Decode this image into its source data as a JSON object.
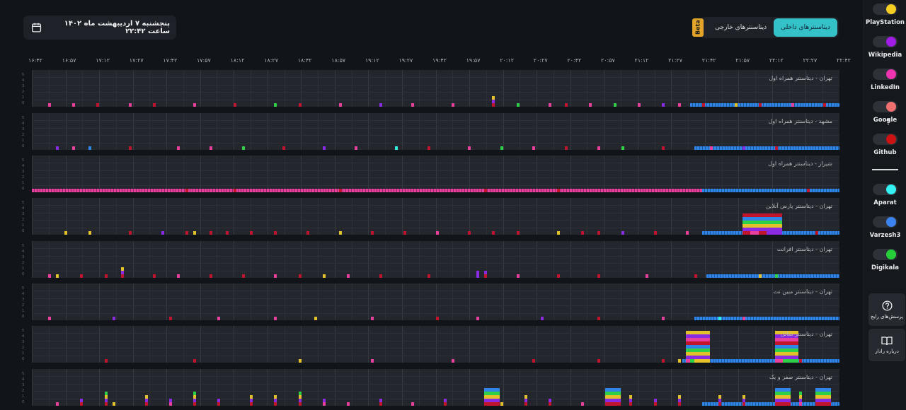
{
  "header": {
    "date_text": "پنجشنبه ۷ اردیبهشت ماه ۱۴۰۲ ساعت ۲۲:۴۲",
    "calendar_icon": "calendar-icon"
  },
  "tabs": {
    "active": "دیتاسنترهای داخلی",
    "inactive": "دیتاسنترهای خارجی",
    "beta": "Beta"
  },
  "time_axis": [
    "۱۶:۴۲",
    "۱۶:۵۷",
    "۱۷:۱۲",
    "۱۷:۲۷",
    "۱۷:۴۲",
    "۱۷:۵۷",
    "۱۸:۱۲",
    "۱۸:۲۷",
    "۱۸:۴۲",
    "۱۸:۵۷",
    "۱۹:۱۲",
    "۱۹:۲۷",
    "۱۹:۴۲",
    "۱۹:۵۷",
    "۲۰:۱۲",
    "۲۰:۲۷",
    "۲۰:۴۲",
    "۲۰:۵۷",
    "۲۱:۱۲",
    "۲۱:۲۷",
    "۲۱:۴۲",
    "۲۱:۵۷",
    "۲۲:۱۲",
    "۲۲:۲۷",
    "۲۲:۴۲"
  ],
  "rows": [
    {
      "label": "تهران - دیتاسنتر همراه اول",
      "base": {
        "start": 0.815,
        "color": "#2f86e8"
      },
      "bars": [
        [
          0.02,
          "#e8409d"
        ],
        [
          0.05,
          "#e8409d"
        ],
        [
          0.08,
          "#c0152c"
        ],
        [
          0.12,
          "#e8409d"
        ],
        [
          0.15,
          "#c0152c"
        ],
        [
          0.2,
          "#e8409d"
        ],
        [
          0.25,
          "#c0152c"
        ],
        [
          0.3,
          "#2fcf47"
        ],
        [
          0.33,
          "#c0152c"
        ],
        [
          0.38,
          "#e8409d"
        ],
        [
          0.43,
          "#8a2be2"
        ],
        [
          0.47,
          "#e8409d"
        ],
        [
          0.52,
          "#e8409d"
        ],
        [
          0.57,
          "#c0152c",
          3
        ],
        [
          0.6,
          "#2fcf47"
        ],
        [
          0.64,
          "#e8409d"
        ],
        [
          0.66,
          "#c0152c"
        ],
        [
          0.69,
          "#e8409d"
        ],
        [
          0.72,
          "#2fcf47"
        ],
        [
          0.75,
          "#e8409d"
        ],
        [
          0.78,
          "#8a2be2"
        ],
        [
          0.8,
          "#e8409d"
        ],
        [
          0.83,
          "#c0152c"
        ],
        [
          0.87,
          "#e3c12a"
        ],
        [
          0.9,
          "#c0152c"
        ],
        [
          0.94,
          "#e8409d"
        ],
        [
          0.98,
          "#c0152c"
        ]
      ]
    },
    {
      "label": "مشهد - دیتاسنتر همراه اول",
      "base": {
        "start": 0.82,
        "color": "#2f86e8"
      },
      "bars": [
        [
          0.03,
          "#8a2be2"
        ],
        [
          0.05,
          "#e8409d"
        ],
        [
          0.07,
          "#2f86e8"
        ],
        [
          0.12,
          "#c0152c"
        ],
        [
          0.18,
          "#e8409d"
        ],
        [
          0.22,
          "#e8409d"
        ],
        [
          0.26,
          "#2fcf47"
        ],
        [
          0.31,
          "#c0152c"
        ],
        [
          0.36,
          "#8a2be2"
        ],
        [
          0.4,
          "#e8409d"
        ],
        [
          0.45,
          "#2ff0e0"
        ],
        [
          0.49,
          "#c0152c"
        ],
        [
          0.54,
          "#e8409d"
        ],
        [
          0.58,
          "#2fcf47"
        ],
        [
          0.62,
          "#e8409d"
        ],
        [
          0.66,
          "#c0152c"
        ],
        [
          0.7,
          "#e8409d"
        ],
        [
          0.73,
          "#2fcf47"
        ],
        [
          0.78,
          "#c0152c"
        ],
        [
          0.84,
          "#e8409d"
        ],
        [
          0.88,
          "#8a2be2"
        ],
        [
          0.92,
          "#c0152c"
        ]
      ]
    },
    {
      "label": "شیراز - دیتاسنتر همراه اول",
      "base": {
        "start": 0.0,
        "color": "#e8409d"
      },
      "overlay": {
        "start": 0.83,
        "color": "#2f86e8"
      },
      "bars": [
        [
          0.19,
          "#c0152c"
        ],
        [
          0.25,
          "#c0152c"
        ],
        [
          0.38,
          "#c0152c"
        ],
        [
          0.56,
          "#c0152c"
        ],
        [
          0.65,
          "#c0152c"
        ],
        [
          0.96,
          "#c0152c"
        ]
      ]
    },
    {
      "label": "تهران - دیتاسنتر پارس آنلاین",
      "base": {
        "start": 0.83,
        "color": "#2f86e8"
      },
      "bars": [
        [
          0.04,
          "#e3c12a"
        ],
        [
          0.07,
          "#e3c12a"
        ],
        [
          0.12,
          "#c0152c"
        ],
        [
          0.16,
          "#8a2be2"
        ],
        [
          0.19,
          "#c0152c"
        ],
        [
          0.2,
          "#e3c12a"
        ],
        [
          0.22,
          "#c0152c"
        ],
        [
          0.24,
          "#c0152c"
        ],
        [
          0.27,
          "#c0152c"
        ],
        [
          0.3,
          "#c0152c"
        ],
        [
          0.34,
          "#c0152c"
        ],
        [
          0.38,
          "#e3c12a"
        ],
        [
          0.42,
          "#c0152c"
        ],
        [
          0.46,
          "#c0152c"
        ],
        [
          0.5,
          "#e8409d"
        ],
        [
          0.54,
          "#c0152c"
        ],
        [
          0.57,
          "#c0152c"
        ],
        [
          0.6,
          "#c0152c"
        ],
        [
          0.65,
          "#e3c12a"
        ],
        [
          0.68,
          "#c0152c"
        ],
        [
          0.7,
          "#c0152c"
        ],
        [
          0.73,
          "#8a2be2"
        ],
        [
          0.77,
          "#c0152c"
        ],
        [
          0.81,
          "#e8409d"
        ],
        [
          0.88,
          "#c0152c",
          6
        ],
        [
          0.89,
          "#e8409d",
          6
        ],
        [
          0.9,
          "#c0152c",
          6
        ],
        [
          0.91,
          "#8a2be2",
          6
        ],
        [
          0.97,
          "#c0152c"
        ]
      ]
    },
    {
      "label": "تهران - دیتاسنتر افرانت",
      "base": {
        "start": 0.835,
        "color": "#2f86e8"
      },
      "bars": [
        [
          0.02,
          "#e8409d"
        ],
        [
          0.03,
          "#e3c12a"
        ],
        [
          0.06,
          "#c0152c"
        ],
        [
          0.09,
          "#c0152c"
        ],
        [
          0.11,
          "#c0152c",
          3
        ],
        [
          0.15,
          "#c0152c"
        ],
        [
          0.18,
          "#e8409d"
        ],
        [
          0.22,
          "#c0152c"
        ],
        [
          0.26,
          "#c0152c"
        ],
        [
          0.3,
          "#e8409d"
        ],
        [
          0.33,
          "#c0152c"
        ],
        [
          0.36,
          "#e3c12a"
        ],
        [
          0.39,
          "#e8409d"
        ],
        [
          0.43,
          "#c0152c"
        ],
        [
          0.49,
          "#c0152c"
        ],
        [
          0.55,
          "#8a2be2",
          2
        ],
        [
          0.56,
          "#c0152c",
          2
        ],
        [
          0.6,
          "#e8409d"
        ],
        [
          0.65,
          "#c0152c"
        ],
        [
          0.7,
          "#c0152c"
        ],
        [
          0.76,
          "#e8409d"
        ],
        [
          0.82,
          "#c0152c"
        ],
        [
          0.9,
          "#e3c12a"
        ],
        [
          0.92,
          "#2fcf47"
        ]
      ]
    },
    {
      "label": "تهران - دیتاسنتر مبین نت",
      "base": {
        "start": 0.82,
        "color": "#2f86e8"
      },
      "bars": [
        [
          0.02,
          "#e8409d"
        ],
        [
          0.1,
          "#8a2be2"
        ],
        [
          0.17,
          "#c0152c"
        ],
        [
          0.23,
          "#e8409d"
        ],
        [
          0.3,
          "#e8409d"
        ],
        [
          0.35,
          "#e3c12a"
        ],
        [
          0.42,
          "#e8409d"
        ],
        [
          0.5,
          "#c0152c"
        ],
        [
          0.55,
          "#e8409d"
        ],
        [
          0.63,
          "#8a2be2"
        ],
        [
          0.7,
          "#c0152c"
        ],
        [
          0.78,
          "#e8409d"
        ],
        [
          0.85,
          "#2ff0e0"
        ],
        [
          0.88,
          "#e8409d"
        ]
      ]
    },
    {
      "label": "تهران - دیتاسنتر شاتل",
      "base": {
        "start": 0.805,
        "color": "#2f86e8"
      },
      "bars": [
        [
          0.09,
          "#c0152c"
        ],
        [
          0.2,
          "#c0152c"
        ],
        [
          0.33,
          "#e3c12a"
        ],
        [
          0.42,
          "#e8409d"
        ],
        [
          0.52,
          "#e8409d"
        ],
        [
          0.62,
          "#c0152c"
        ],
        [
          0.7,
          "#c0152c"
        ],
        [
          0.78,
          "#c0152c"
        ],
        [
          0.8,
          "#e3c12a"
        ],
        [
          0.81,
          "#e8409d",
          9
        ],
        [
          0.815,
          "#2fcf47",
          9
        ],
        [
          0.82,
          "#e3c12a",
          9
        ],
        [
          0.92,
          "#e8409d",
          9
        ],
        [
          0.93,
          "#2fcf47",
          9
        ],
        [
          0.95,
          "#c0152c"
        ]
      ]
    },
    {
      "label": "تهران - دیتاسنتر صفر و یک",
      "base": {
        "start": 0.83,
        "color": "#2f86e8"
      },
      "bars": [
        [
          0.03,
          "#e8409d"
        ],
        [
          0.06,
          "#c0152c",
          2
        ],
        [
          0.09,
          "#c0152c",
          4
        ],
        [
          0.1,
          "#e3c12a"
        ],
        [
          0.14,
          "#c0152c",
          3
        ],
        [
          0.17,
          "#e8409d",
          2
        ],
        [
          0.2,
          "#c0152c",
          4
        ],
        [
          0.23,
          "#c0152c",
          2
        ],
        [
          0.27,
          "#c0152c",
          3
        ],
        [
          0.3,
          "#c0152c",
          3
        ],
        [
          0.33,
          "#c0152c",
          4
        ],
        [
          0.36,
          "#e8409d",
          2
        ],
        [
          0.39,
          "#e8409d"
        ],
        [
          0.43,
          "#c0152c",
          2
        ],
        [
          0.47,
          "#e8409d"
        ],
        [
          0.51,
          "#c0152c",
          2
        ],
        [
          0.56,
          "#c0152c",
          5
        ],
        [
          0.58,
          "#e3c12a"
        ],
        [
          0.61,
          "#c0152c",
          3
        ],
        [
          0.64,
          "#c0152c",
          2
        ],
        [
          0.68,
          "#e8409d"
        ],
        [
          0.71,
          "#c0152c",
          5
        ],
        [
          0.74,
          "#c0152c",
          3
        ],
        [
          0.77,
          "#c0152c",
          2
        ],
        [
          0.8,
          "#c0152c",
          3
        ],
        [
          0.85,
          "#c0152c",
          3
        ],
        [
          0.88,
          "#c0152c",
          3
        ],
        [
          0.92,
          "#c0152c",
          5
        ],
        [
          0.95,
          "#e8409d",
          4
        ],
        [
          0.97,
          "#c0152c",
          5
        ]
      ]
    }
  ],
  "sidebar": {
    "services_top": [
      {
        "name": "PlayStation",
        "color": "#f4cf21"
      },
      {
        "name": "Wikipedia",
        "color": "#a21ce8"
      },
      {
        "name": "LinkedIn",
        "color": "#ee34b1"
      },
      {
        "name": "Google",
        "color": "#f07070"
      },
      {
        "name": "Github",
        "color": "#cc1212"
      }
    ],
    "services_bottom": [
      {
        "name": "Aparat",
        "color": "#35f2f2"
      },
      {
        "name": "Varzesh3",
        "color": "#3b83f0"
      },
      {
        "name": "Digikala",
        "color": "#26cf3a"
      }
    ],
    "faq": {
      "label": "پرسش‌های رایج",
      "icon": "help-circle-icon"
    },
    "about": {
      "label": "درباره رادار",
      "icon": "open-book-icon"
    }
  }
}
